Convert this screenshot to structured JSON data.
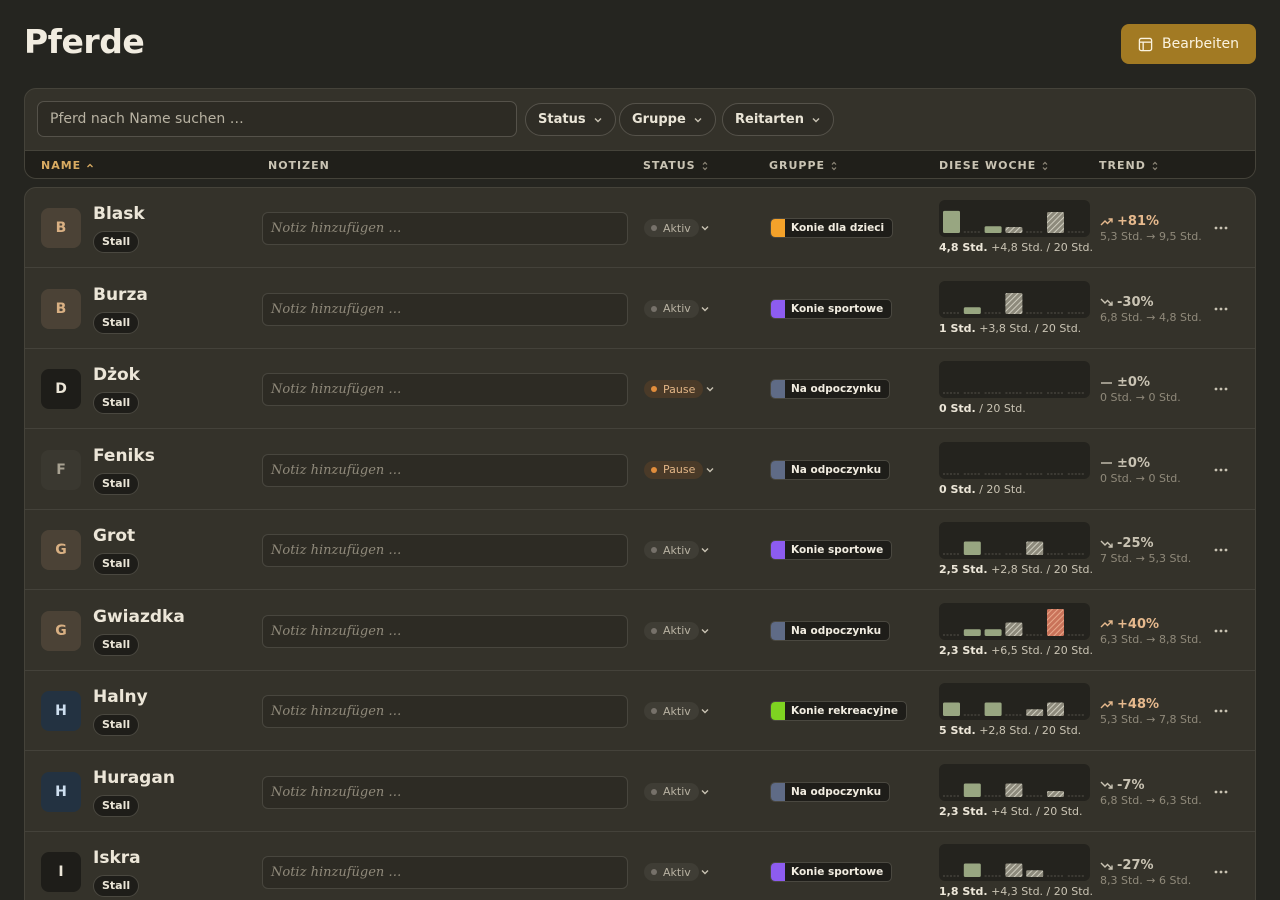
{
  "page": {
    "title": "Pferde",
    "edit_label": "Bearbeiten"
  },
  "filters": {
    "search_placeholder": "Pferd nach Name suchen …",
    "status_label": "Status",
    "group_label": "Gruppe",
    "riding_label": "Reitarten"
  },
  "columns": {
    "name": "NAME",
    "notes": "NOTIZEN",
    "status": "STATUS",
    "group": "GRUPPE",
    "week": "DIESE WOCHE",
    "trend": "TREND"
  },
  "colors": {
    "accent": "#a27a23",
    "sort_active": "#d9ab62",
    "bar_solid": "#98a681",
    "bar_over": "#c9735a",
    "trend_up": "#e6b98d",
    "trend_down": "#c9c3b3"
  },
  "rows": [
    {
      "initial": "B",
      "name": "Blask",
      "tag": "Stall",
      "note_placeholder": "Notiz hinzufügen …",
      "status": "Aktiv",
      "status_kind": "aktiv",
      "group": "Konie dla dzieci",
      "group_color": "#f4a22a",
      "week_main": "4,8 Std.",
      "week_extra": "+4,8 Std.",
      "week_total": "/ 20 Std.",
      "trend_dir": "up",
      "trend_pct": "+81%",
      "trend_sub": "5,3 Std. → 9,5 Std.",
      "bars": [
        [
          "s",
          0.82
        ],
        [
          "d",
          0
        ],
        [
          "s",
          0.25
        ],
        [
          "h",
          0.22
        ],
        [
          "d",
          0
        ],
        [
          "h",
          0.78
        ],
        [
          "d",
          0
        ]
      ]
    },
    {
      "initial": "B",
      "name": "Burza",
      "tag": "Stall",
      "note_placeholder": "Notiz hinzufügen …",
      "status": "Aktiv",
      "status_kind": "aktiv",
      "group": "Konie sportowe",
      "group_color": "#8d5cf0",
      "week_main": "1 Std.",
      "week_extra": "+3,8 Std.",
      "week_total": "/ 20 Std.",
      "trend_dir": "down",
      "trend_pct": "-30%",
      "trend_sub": "6,8 Std. → 4,8 Std.",
      "bars": [
        [
          "d",
          0
        ],
        [
          "s",
          0.25
        ],
        [
          "d",
          0
        ],
        [
          "h",
          0.78
        ],
        [
          "d",
          0
        ],
        [
          "d",
          0
        ],
        [
          "d",
          0
        ]
      ]
    },
    {
      "initial": "D",
      "name": "Dżok",
      "tag": "Stall",
      "note_placeholder": "Notiz hinzufügen …",
      "status": "Pause",
      "status_kind": "pause",
      "group": "Na odpoczynku",
      "group_color": "#5f6b86",
      "week_main": "0 Std.",
      "week_extra": "",
      "week_total": "/ 20 Std.",
      "trend_dir": "flat",
      "trend_pct": "±0%",
      "trend_sub": "0 Std. → 0 Std.",
      "bars": [
        [
          "d",
          0
        ],
        [
          "d",
          0
        ],
        [
          "d",
          0
        ],
        [
          "d",
          0
        ],
        [
          "d",
          0
        ],
        [
          "d",
          0
        ],
        [
          "d",
          0
        ]
      ]
    },
    {
      "initial": "F",
      "name": "Feniks",
      "tag": "Stall",
      "note_placeholder": "Notiz hinzufügen …",
      "status": "Pause",
      "status_kind": "pause",
      "group": "Na odpoczynku",
      "group_color": "#5f6b86",
      "week_main": "0 Std.",
      "week_extra": "",
      "week_total": "/ 20 Std.",
      "trend_dir": "flat",
      "trend_pct": "±0%",
      "trend_sub": "0 Std. → 0 Std.",
      "bars": [
        [
          "d",
          0
        ],
        [
          "d",
          0
        ],
        [
          "d",
          0
        ],
        [
          "d",
          0
        ],
        [
          "d",
          0
        ],
        [
          "d",
          0
        ],
        [
          "d",
          0
        ]
      ]
    },
    {
      "initial": "G",
      "name": "Grot",
      "tag": "Stall",
      "note_placeholder": "Notiz hinzufügen …",
      "status": "Aktiv",
      "status_kind": "aktiv",
      "group": "Konie sportowe",
      "group_color": "#8d5cf0",
      "week_main": "2,5 Std.",
      "week_extra": "+2,8 Std.",
      "week_total": "/ 20 Std.",
      "trend_dir": "down",
      "trend_pct": "-25%",
      "trend_sub": "7 Std. → 5,3 Std.",
      "bars": [
        [
          "d",
          0
        ],
        [
          "s",
          0.5
        ],
        [
          "d",
          0
        ],
        [
          "d",
          0
        ],
        [
          "h",
          0.5
        ],
        [
          "d",
          0
        ],
        [
          "d",
          0
        ]
      ]
    },
    {
      "initial": "G",
      "name": "Gwiazdka",
      "tag": "Stall",
      "note_placeholder": "Notiz hinzufügen …",
      "status": "Aktiv",
      "status_kind": "aktiv",
      "group": "Na odpoczynku",
      "group_color": "#5f6b86",
      "week_main": "2,3 Std.",
      "week_extra": "+6,5 Std.",
      "week_total": "/ 20 Std.",
      "trend_dir": "up",
      "trend_pct": "+40%",
      "trend_sub": "6,3 Std. → 8,8 Std.",
      "bars": [
        [
          "d",
          0
        ],
        [
          "s",
          0.25
        ],
        [
          "s",
          0.25
        ],
        [
          "h",
          0.5
        ],
        [
          "d",
          0
        ],
        [
          "o",
          1.0
        ],
        [
          "d",
          0
        ]
      ]
    },
    {
      "initial": "H",
      "name": "Halny",
      "tag": "Stall",
      "note_placeholder": "Notiz hinzufügen …",
      "status": "Aktiv",
      "status_kind": "aktiv",
      "group": "Konie rekreacyjne",
      "group_color": "#7ed321",
      "week_main": "5 Std.",
      "week_extra": "+2,8 Std.",
      "week_total": "/ 20 Std.",
      "trend_dir": "up",
      "trend_pct": "+48%",
      "trend_sub": "5,3 Std. → 7,8 Std.",
      "bars": [
        [
          "s",
          0.5
        ],
        [
          "d",
          0
        ],
        [
          "s",
          0.5
        ],
        [
          "d",
          0
        ],
        [
          "h",
          0.25
        ],
        [
          "h",
          0.5
        ],
        [
          "d",
          0
        ]
      ]
    },
    {
      "initial": "H",
      "name": "Huragan",
      "tag": "Stall",
      "note_placeholder": "Notiz hinzufügen …",
      "status": "Aktiv",
      "status_kind": "aktiv",
      "group": "Na odpoczynku",
      "group_color": "#5f6b86",
      "week_main": "2,3 Std.",
      "week_extra": "+4 Std.",
      "week_total": "/ 20 Std.",
      "trend_dir": "down",
      "trend_pct": "-7%",
      "trend_sub": "6,8 Std. → 6,3 Std.",
      "bars": [
        [
          "d",
          0
        ],
        [
          "s",
          0.5
        ],
        [
          "d",
          0
        ],
        [
          "h",
          0.5
        ],
        [
          "d",
          0
        ],
        [
          "h",
          0.22
        ],
        [
          "d",
          0
        ]
      ]
    },
    {
      "initial": "I",
      "name": "Iskra",
      "tag": "Stall",
      "note_placeholder": "Notiz hinzufügen …",
      "status": "Aktiv",
      "status_kind": "aktiv",
      "group": "Konie sportowe",
      "group_color": "#8d5cf0",
      "week_main": "1,8 Std.",
      "week_extra": "+4,3 Std.",
      "week_total": "/ 20 Std.",
      "trend_dir": "down",
      "trend_pct": "-27%",
      "trend_sub": "8,3 Std. → 6 Std.",
      "bars": [
        [
          "d",
          0
        ],
        [
          "s",
          0.5
        ],
        [
          "d",
          0
        ],
        [
          "h",
          0.5
        ],
        [
          "h",
          0.25
        ],
        [
          "d",
          0
        ],
        [
          "d",
          0
        ]
      ]
    }
  ]
}
